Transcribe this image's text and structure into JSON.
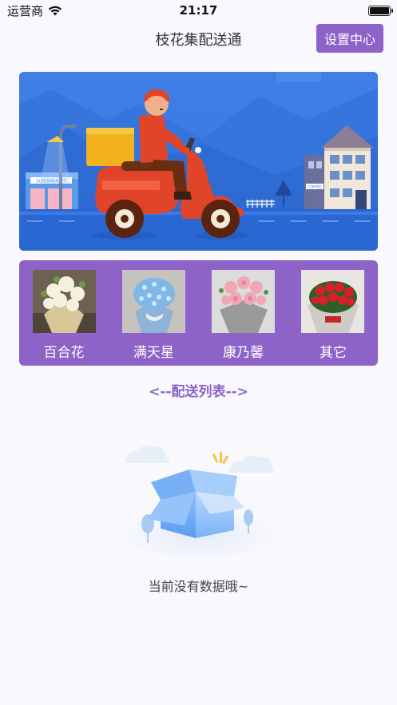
{
  "status_bar": {
    "carrier": "运营商",
    "time": "21:17"
  },
  "nav": {
    "title": "枝花集配送通",
    "settings_label": "设置中心"
  },
  "banner": {
    "shop_sign": "SUPERMARKET",
    "cafe_sign": "COFFEE"
  },
  "categories": [
    {
      "label": "百合花",
      "flower_color": "#f4f1e0"
    },
    {
      "label": "满天星",
      "flower_color": "#7fb8e6"
    },
    {
      "label": "康乃馨",
      "flower_color": "#f1a7b6"
    },
    {
      "label": "其它",
      "flower_color": "#d8202a"
    }
  ],
  "list": {
    "title": "<--配送列表-->",
    "empty_text": "当前没有数据哦~"
  },
  "colors": {
    "accent": "#8e63c8",
    "banner": "#3a7be0",
    "background": "#f8f8fd"
  }
}
